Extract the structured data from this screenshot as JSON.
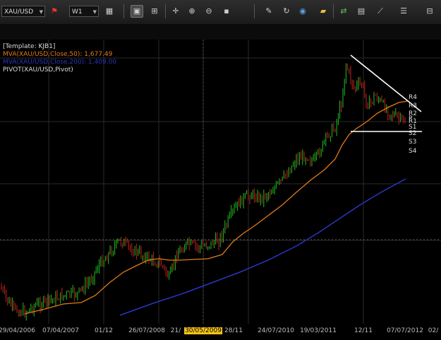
{
  "toolbar": {
    "symbol": "XAU/USD",
    "timeframe": "W1",
    "icons": [
      "flag-icon",
      "chart-type-icon",
      "template-icon",
      "layout-icon",
      "crosshair-icon",
      "zoom-in-icon",
      "zoom-out-icon",
      "cursor-icon",
      "color-icon",
      "refresh-icon",
      "globe-icon",
      "ruler-icon",
      "trade-icon",
      "window-icon",
      "drawing-icon",
      "list-icon",
      "lock-icon"
    ]
  },
  "legend": {
    "template": "[Template: KJB1]",
    "mva50": "MVA(XAU/USD,Close,50): 1,677.49",
    "mva200": "MVA(XAU/USD,Close,200): 1,409.00",
    "pivot": "PIVOT(XAU/USD,Pivot)",
    "colors": {
      "mva50": "#e07b1a",
      "mva200": "#2a35c0",
      "pivot": "#ffffff"
    }
  },
  "pivot_labels": [
    "R4",
    "R3",
    "R2",
    "P",
    "R1",
    "S1",
    "S2",
    "S3",
    "S4"
  ],
  "xaxis": {
    "labels": [
      "29/04/2006",
      "07/04/2007",
      "01/12",
      "26/07/2008",
      "21/",
      "30/05/2009",
      "28/11",
      "24/07/2010",
      "19/03/2011",
      "12/11",
      "07/07/2012",
      "02/"
    ],
    "highlighted": "30/05/2009"
  },
  "colors": {
    "bull": "#1fbf1f",
    "bear": "#c0221e",
    "background": "#000000",
    "grid": "#444444"
  }
}
